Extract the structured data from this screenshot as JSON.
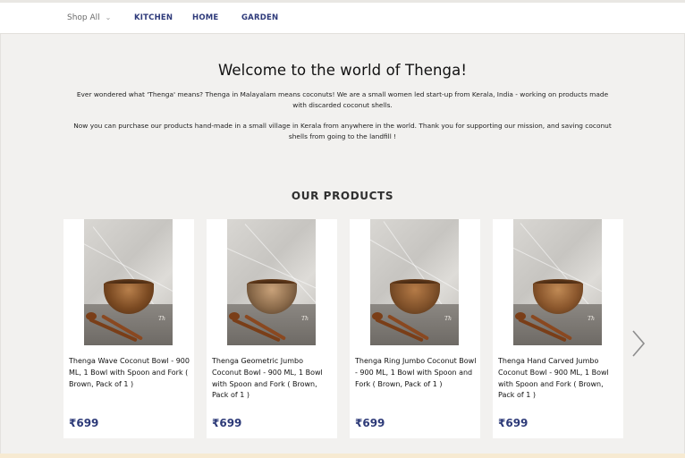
{
  "nav": {
    "shop_all": "Shop All",
    "links": [
      "KITCHEN",
      "HOME",
      "GARDEN"
    ]
  },
  "welcome": {
    "title": "Welcome to the world of Thenga!",
    "paragraph_1": "Ever wondered what 'Thenga' means? Thenga in Malayalam means coconuts! We are a small women led start-up from Kerala, India - working on products made with discarded coconut shells.",
    "paragraph_2": "Now you can purchase our products hand-made in a small village in Kerala from anywhere in the world. Thank you for supporting our mission, and saving coconut shells from going to the landfill !"
  },
  "products_section": {
    "title": "OUR PRODUCTS",
    "items": [
      {
        "name": "Thenga Wave Coconut Bowl - 900 ML, 1 Bowl with Spoon and Fork ( Brown, Pack of 1 )",
        "price": "₹699"
      },
      {
        "name": "Thenga Geometric Jumbo Coconut Bowl - 900 ML, 1 Bowl with Spoon and Fork ( Brown, Pack of 1 )",
        "price": "₹699"
      },
      {
        "name": "Thenga Ring Jumbo Coconut Bowl - 900 ML, 1 Bowl with Spoon and Fork ( Brown, Pack of 1 )",
        "price": "₹699"
      },
      {
        "name": "Thenga Hand Carved Jumbo Coconut Bowl - 900 ML, 1 Bowl with Spoon and Fork ( Brown, Pack of 1 )",
        "price": "₹699"
      }
    ]
  },
  "icons": {
    "shop_all_dropdown": "chevron-down-icon",
    "carousel_next": "chevron-right-icon"
  },
  "colors": {
    "nav_link": "#2e3a7a",
    "price": "#2d3a78",
    "page_background": "#f2f1ef"
  }
}
